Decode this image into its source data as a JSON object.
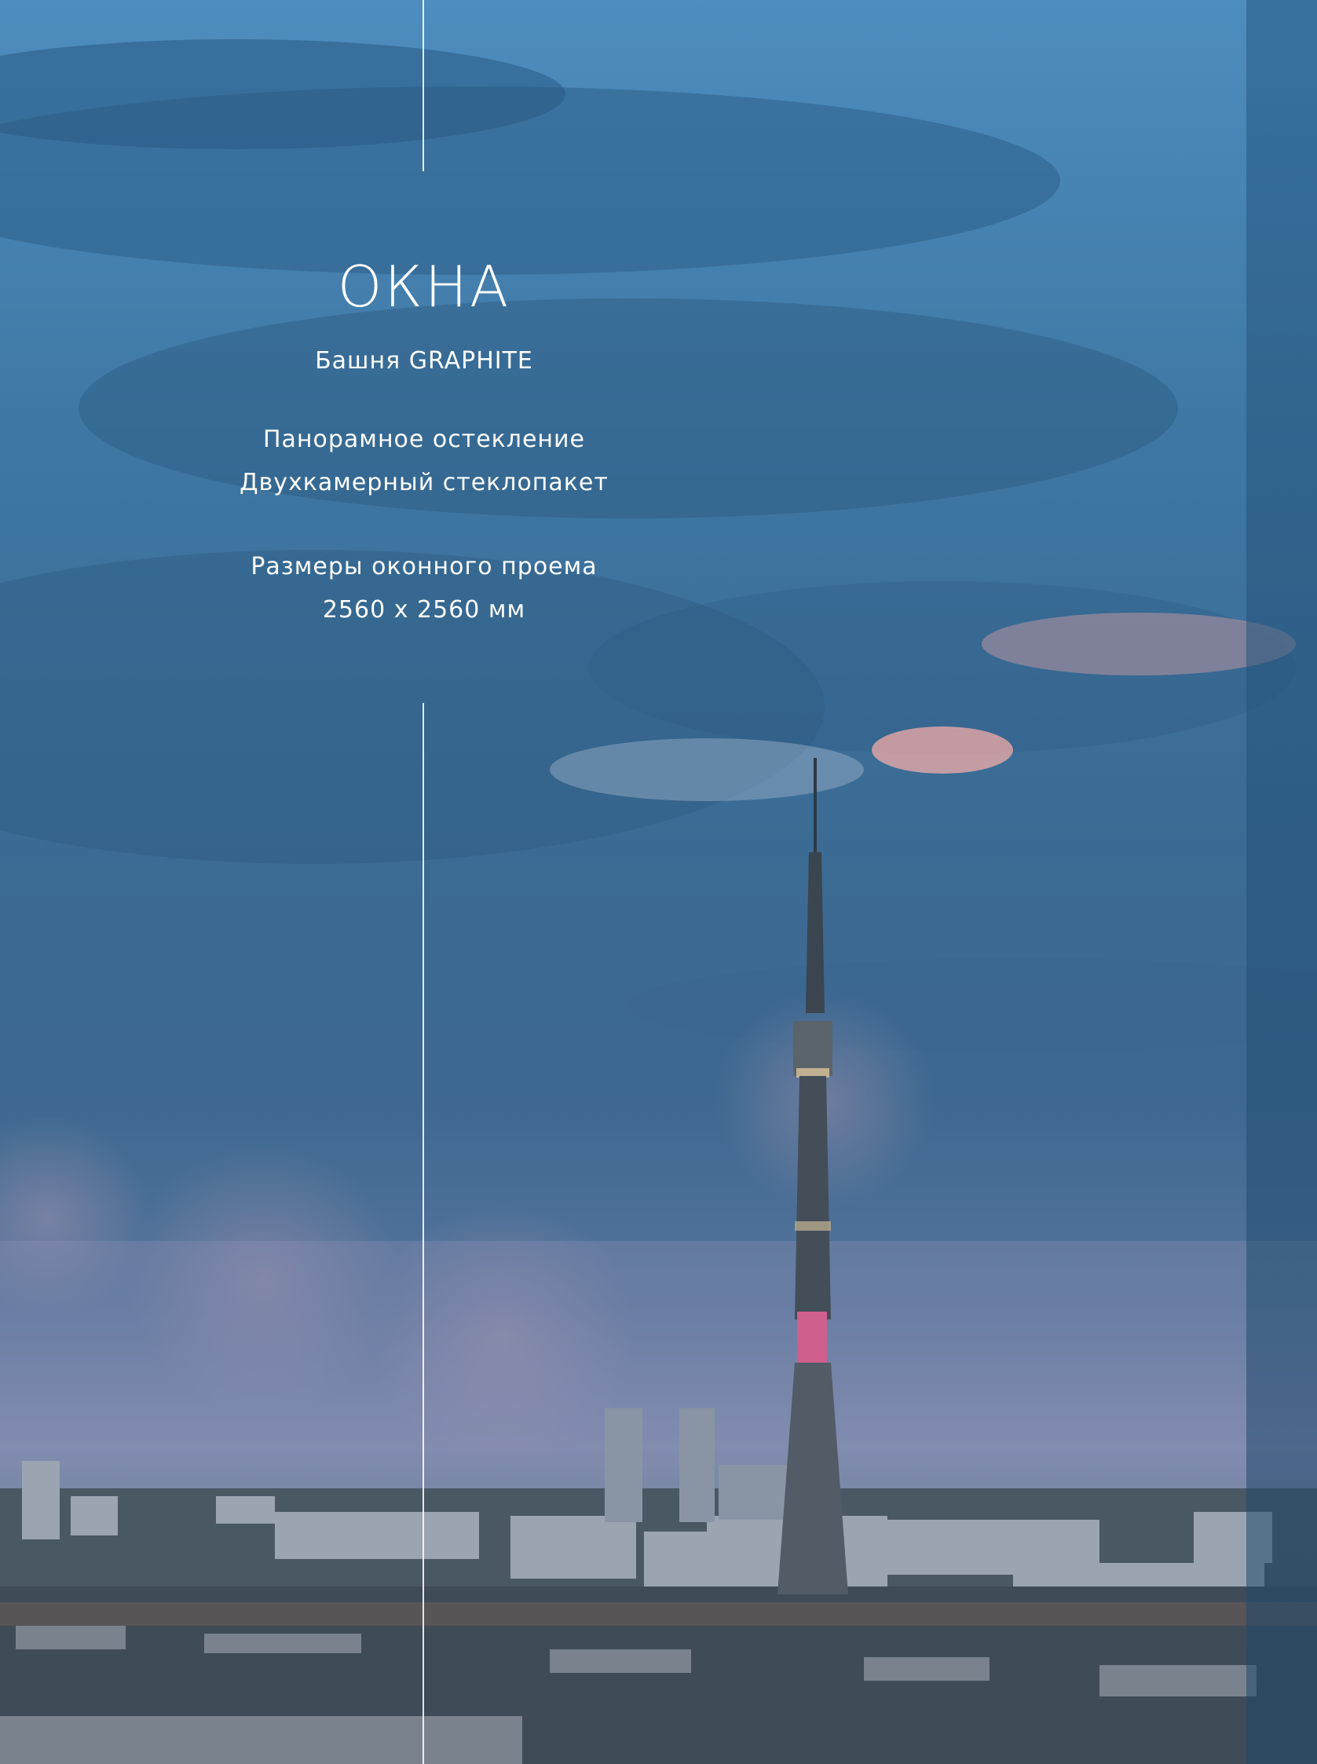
{
  "heading": {
    "title": "ОКНА",
    "subtitle": "Башня GRAPHITE"
  },
  "glazing": {
    "line1": "Панорамное остекление",
    "line2": "Двухкамерный стеклопакет"
  },
  "opening": {
    "label": "Размеры оконного проема",
    "size": "2560 х 2560 мм"
  },
  "colors": {
    "sky_top": "#4f8cbc",
    "sky_mid": "#3c6f98",
    "sky_low": "#6f86a8",
    "city": "#4e5a66",
    "text": "#ffffff"
  }
}
